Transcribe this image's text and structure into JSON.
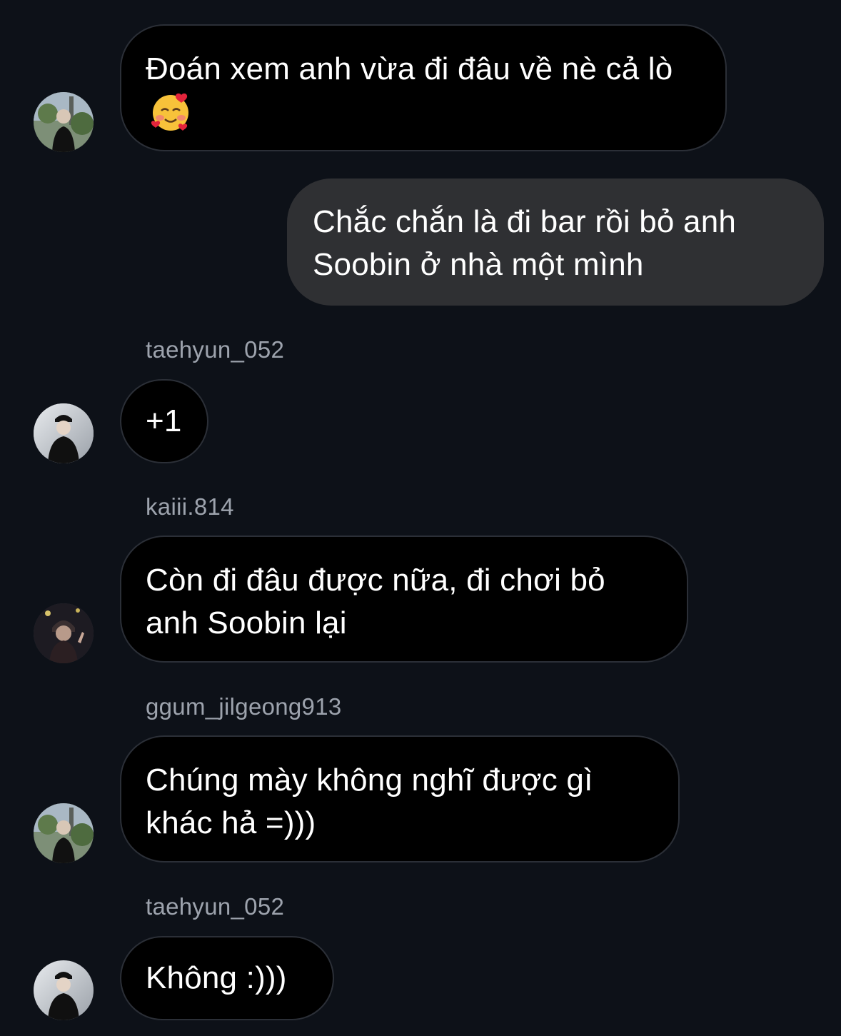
{
  "conversation": {
    "messages": [
      {
        "id": "m1",
        "direction": "incoming",
        "sender": "",
        "text": "Đoán xem anh vừa đi đâu về nè cả lò",
        "emoji_name": "smiling-face-with-hearts-icon",
        "avatar_name": "avatar-user-1"
      },
      {
        "id": "m2",
        "direction": "outgoing",
        "sender": "",
        "text": "Chắc chắn là đi bar rồi bỏ anh Soobin ở nhà một mình"
      },
      {
        "id": "m3",
        "direction": "incoming",
        "sender": "taehyun_052",
        "text": "+1",
        "avatar_name": "avatar-taehyun"
      },
      {
        "id": "m4",
        "direction": "incoming",
        "sender": "kaiii.814",
        "text": "Còn đi đâu được nữa, đi chơi bỏ anh Soobin lại",
        "avatar_name": "avatar-kaiii"
      },
      {
        "id": "m5",
        "direction": "incoming",
        "sender": "ggum_jilgeong913",
        "text": "Chúng mày không nghĩ được gì khác hả =)))",
        "avatar_name": "avatar-ggum"
      },
      {
        "id": "m6",
        "direction": "incoming",
        "sender": "taehyun_052",
        "text": "Không :)))",
        "avatar_name": "avatar-taehyun"
      }
    ]
  },
  "colors": {
    "background": "#0d1118",
    "incoming_bubble": "#000000",
    "incoming_border": "#2b2f37",
    "outgoing_bubble": "#2f3033",
    "sender_text": "#9da3ad",
    "message_text": "#ffffff"
  }
}
